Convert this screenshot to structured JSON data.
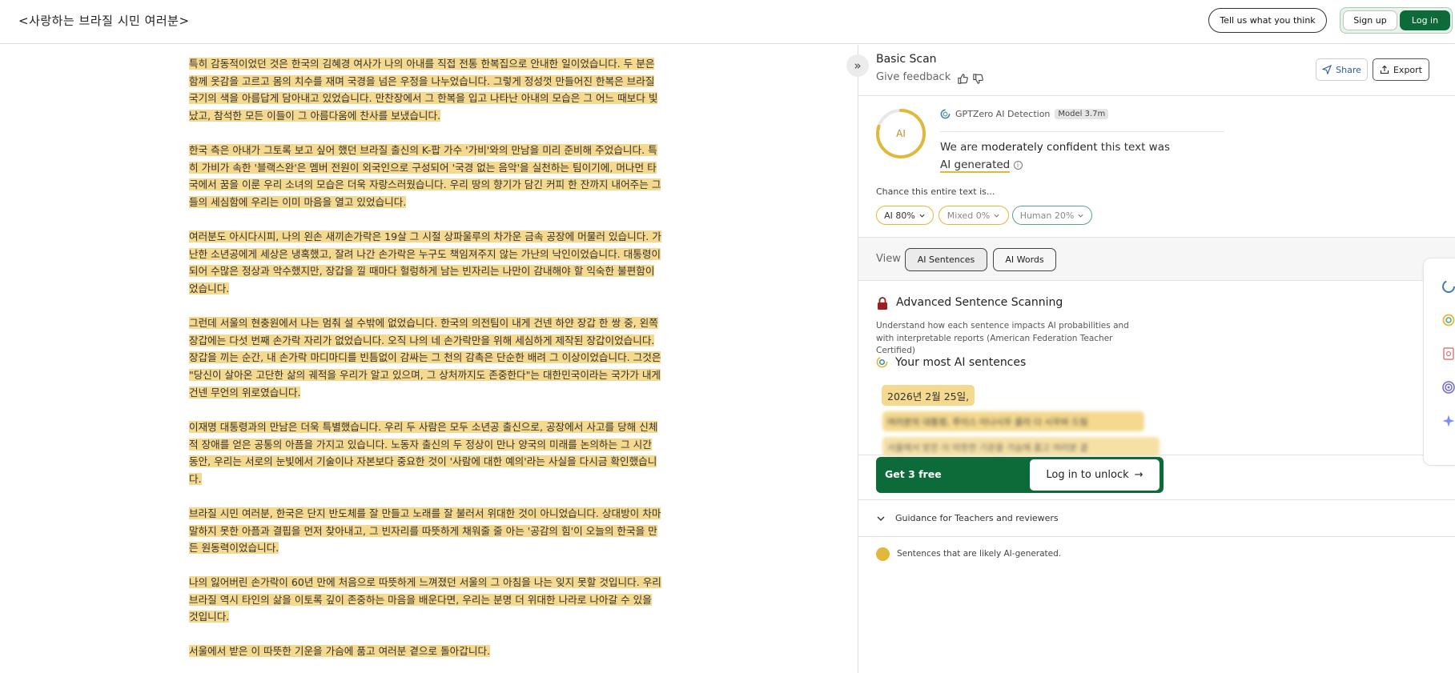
{
  "header": {
    "doc_title": "<사랑하는 브라질 시민 여러분>",
    "feedback_label": "Tell us what you think",
    "signup_label": "Sign up",
    "login_label": "Log in"
  },
  "document": {
    "paragraphs": [
      "특히 감동적이었던 것은 한국의 김혜경 여사가 나의 아내를 직접 전통 한복집으로 안내한 일이었습니다. 두 분은 함께 옷감을 고르고 몸의 치수를 재며 국경을 넘은 우정을 나누었습니다. 그렇게 정성껏 만들어진 한복은 브라질 국기의 색을 아름답게 담아내고 있었습니다. 만찬장에서 그 한복을 입고 나타난 아내의 모습은 그 어느 때보다 빛났고, 참석한 모든 이들이 그 아름다움에 찬사를 보냈습니다.",
      "한국 측은 아내가 그토록 보고 싶어 했던 브라질 출신의 K-팝 가수 '가비'와의 만남을 미리 준비해 주었습니다. 특히 가비가 속한 '블랙스완'은 멤버 전원이 외국인으로 구성되어 '국경 없는 음악'을 실천하는 팀이기에, 머나먼 타국에서 꿈을 이룬 우리 소녀의 모습은 더욱 자랑스러웠습니다. 우리 땅의 향기가 담긴 커피 한 잔까지 내어주는 그들의 세심함에 우리는 이미 마음을 열고 있었습니다.",
      "여러분도 아시다시피, 나의 왼손 새끼손가락은 19살 그 시절 상파울루의 차가운 금속 공장에 머물러 있습니다. 가난한 소년공에게 세상은 냉혹했고, 잘려 나간 손가락은 누구도 책임져주지 않는 가난의 낙인이었습니다. 대통령이 되어 수많은 정상과 악수했지만, 장갑을 낄 때마다 헐렁하게 남는 빈자리는 나만이 감내해야 할 익숙한 불편함이었습니다.",
      "그런데 서울의 현충원에서 나는 멈춰 설 수밖에 없었습니다. 한국의 의전팀이 내게 건넨 하얀 장갑 한 쌍 중, 왼쪽 장갑에는 다섯 번째 손가락 자리가 없었습니다. 오직 나의 네 손가락만을 위해 세심하게 제작된 장갑이었습니다. 장갑을 끼는 순간, 내 손가락 마디마디를 빈틈없이 감싸는 그 천의 감촉은 단순한 배려 그 이상이었습니다. 그것은 \"당신이 살아온 고단한 삶의 궤적을 우리가 알고 있으며, 그 상처까지도 존중한다\"는 대한민국이라는 국가가 내게 건넨 무언의 위로였습니다.",
      "이재명 대통령과의 만남은 더욱 특별했습니다. 우리 두 사람은 모두 소년공 출신으로, 공장에서 사고를 당해 신체적 장애를 얻은 공통의 아픔을 가지고 있습니다. 노동자 출신의 두 정상이 만나 양국의 미래를 논의하는 그 시간 동안, 우리는 서로의 눈빛에서 기술이나 자본보다 중요한 것이 '사람에 대한 예의'라는 사실을 다시금 확인했습니다.",
      "브라질 시민 여러분, 한국은 단지 반도체를 잘 만들고 노래를 잘 불러서 위대한 것이 아니었습니다. 상대방이 차마 말하지 못한 아픔과 결핍을 먼저 찾아내고, 그 빈자리를 따뜻하게 채워줄 줄 아는 '공감의 힘'이 오늘의 한국을 만든 원동력이었습니다.",
      "나의 잃어버린 손가락이 60년 만에 처음으로 따뜻하게 느껴졌던 서울의 그 아침을 나는 잊지 못할 것입니다. 우리 브라질 역시 타인의 삶을 이토록 깊이 존중하는 마음을 배운다면, 우리는 분명 더 위대한 나라로 나아갈 수 있을 것입니다.",
      "서울에서 받은 이 따뜻한 기운을 가슴에 품고 여러분 곁으로 돌아갑니다."
    ]
  },
  "panel": {
    "scan_title": "Basic Scan",
    "give_feedback": "Give feedback",
    "share_label": "Share",
    "export_label": "Export",
    "gauge_label": "AI",
    "gauge_level": 0.8,
    "detector_label": "GPTZero AI Detection",
    "model_badge": "Model 3.7m",
    "verdict": {
      "prefix": "We are ",
      "confidence": "moderately confident",
      "middle": " this text was ",
      "result": "AI generated"
    },
    "chance_label": "Chance this entire text is...",
    "chips": {
      "ai": "AI 80%",
      "mixed": "Mixed 0%",
      "human": "Human 20%"
    },
    "view_label": "View",
    "tabs": {
      "sentences": "AI Sentences",
      "words": "AI Words"
    },
    "advanced_title": "Advanced Sentence Scanning",
    "advanced_desc": "Understand how each sentence impacts AI probabilities and with interpretable reports (American Federation Teacher Certified)",
    "most_ai_title": "Your most AI sentences",
    "sample_sentences": [
      "2026년 2월 25일,",
      "여러분의 대통령, 루이스 이나시우 룰라 다 시우바 드림",
      "서울에서 받은 이 따뜻한 기운을 가슴에 품고 여러분 곁"
    ],
    "get_free": "Get 3 free",
    "login_unlock": "Log in to unlock",
    "guidance": "Guidance for Teachers and reviewers",
    "legend": "Sentences that are likely AI-generated."
  },
  "colors": {
    "highlight": "#f4d98e",
    "accent_green": "#0d6b3a",
    "gauge_yellow": "#e0b83a",
    "human_green": "#59a58a"
  },
  "icons": {
    "collapse": "double-chevron-right-icon",
    "thumbs_up": "thumbs-up-icon",
    "thumbs_down": "thumbs-down-icon",
    "share": "send-icon",
    "export": "upload-icon",
    "lock": "lock-icon",
    "arrow": "arrow-right-icon"
  }
}
